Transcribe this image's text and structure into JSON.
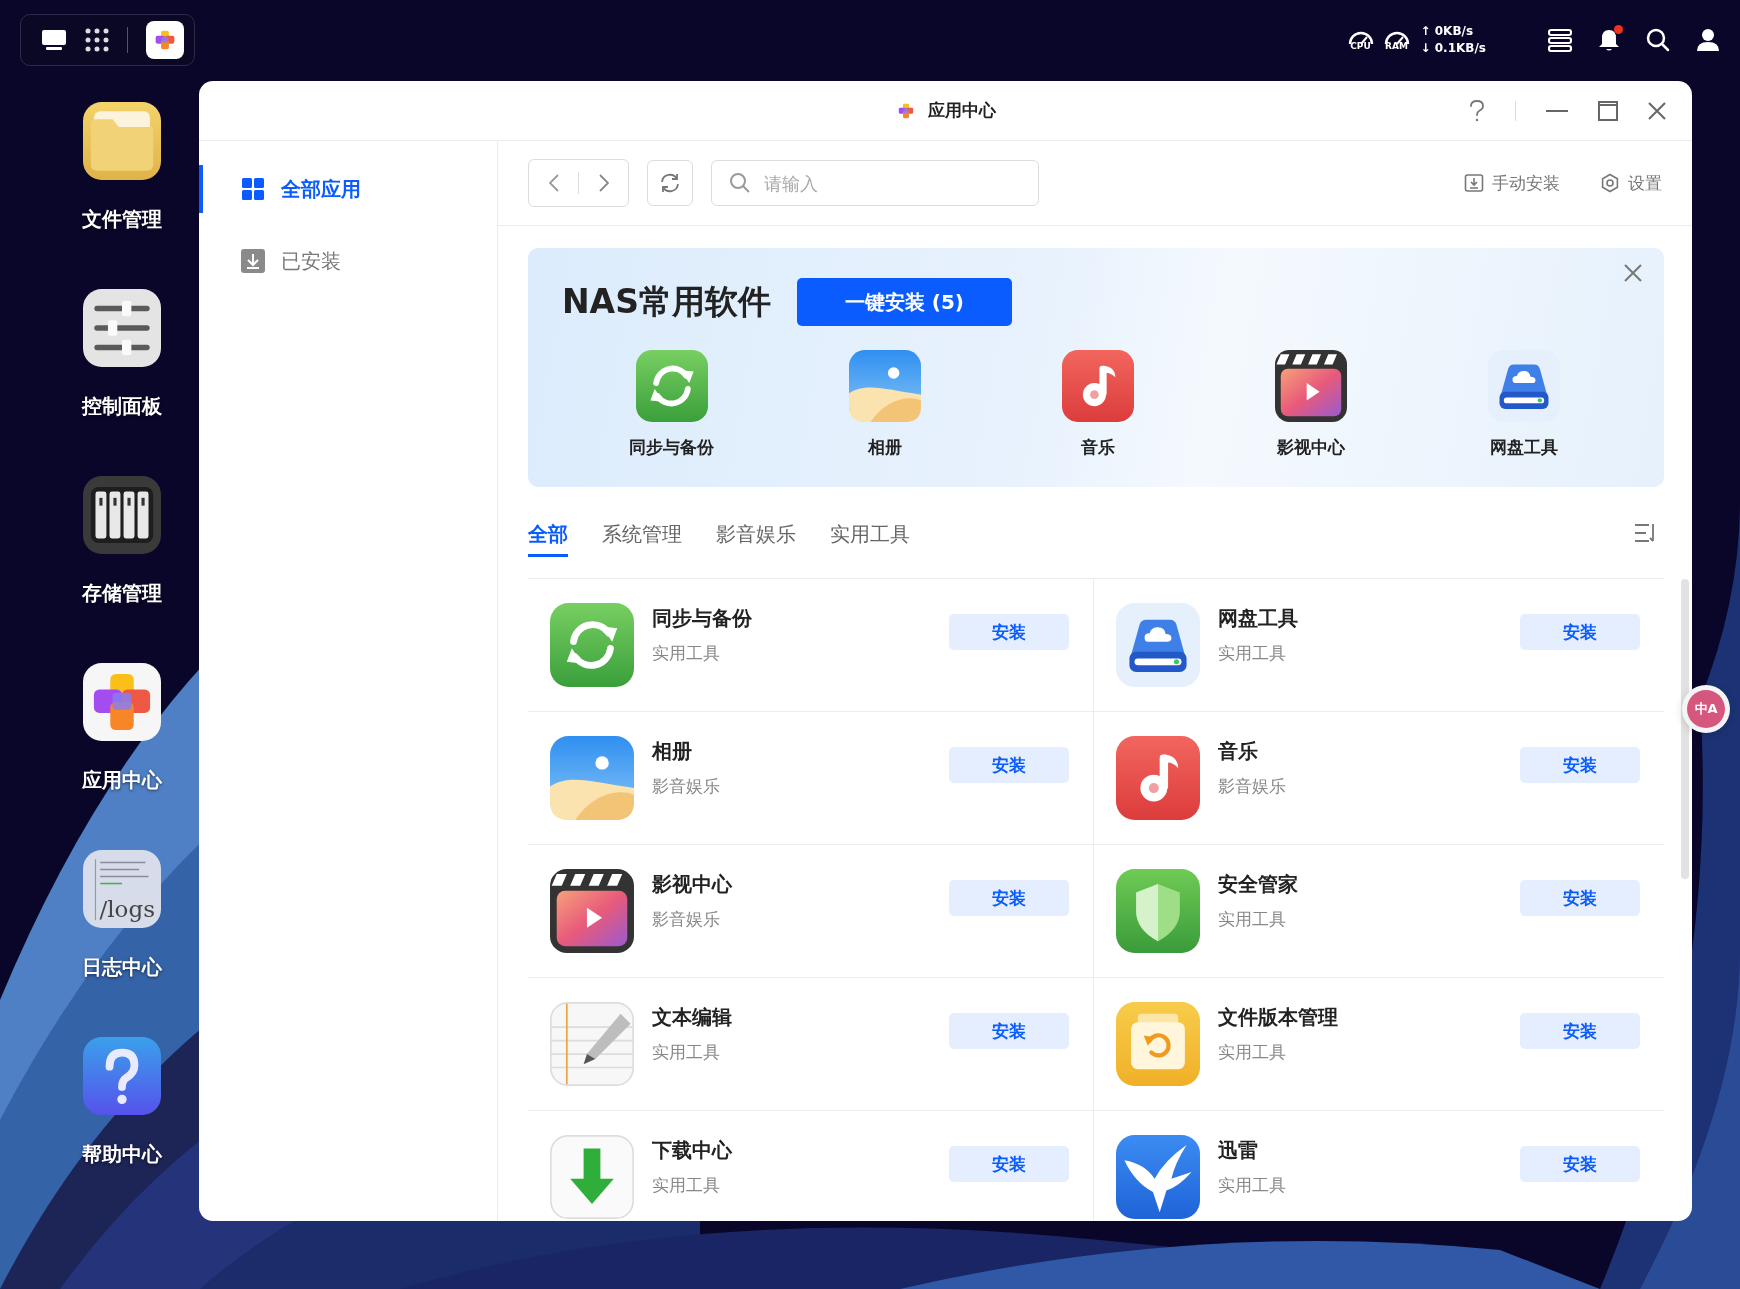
{
  "status": {
    "cpu_label": "CPU",
    "ram_label": "RAM",
    "upload": "↑ 0KB/s",
    "download": "↓ 0.1KB/s",
    "notifications_unread": true
  },
  "desktop_icons": [
    {
      "label": "文件管理",
      "kind": "folder"
    },
    {
      "label": "控制面板",
      "kind": "sliders"
    },
    {
      "label": "存储管理",
      "kind": "storage"
    },
    {
      "label": "应用中心",
      "kind": "appcenter"
    },
    {
      "label": "日志中心",
      "kind": "logs",
      "icon_text": "/logs"
    },
    {
      "label": "帮助中心",
      "kind": "help"
    }
  ],
  "window": {
    "title": "应用中心"
  },
  "sidebar": {
    "items": [
      {
        "label": "全部应用",
        "kind": "grid",
        "selected": true
      },
      {
        "label": "已安装",
        "kind": "installed",
        "selected": false
      }
    ]
  },
  "toolbar": {
    "search": {
      "placeholder": "请输入"
    },
    "actions": [
      {
        "label": "手动安装",
        "kind": "install"
      },
      {
        "label": "设置",
        "kind": "settings"
      }
    ]
  },
  "banner": {
    "title": "NAS常用软件",
    "button": "一键安装 (5)",
    "apps": [
      {
        "label": "同步与备份",
        "kind": "sync"
      },
      {
        "label": "相册",
        "kind": "photos"
      },
      {
        "label": "音乐",
        "kind": "music"
      },
      {
        "label": "影视中心",
        "kind": "video"
      },
      {
        "label": "网盘工具",
        "kind": "disk"
      }
    ]
  },
  "tabs": [
    {
      "label": "全部",
      "selected": true
    },
    {
      "label": "系统管理",
      "selected": false
    },
    {
      "label": "影音娱乐",
      "selected": false
    },
    {
      "label": "实用工具",
      "selected": false
    }
  ],
  "apps": [
    {
      "name": "同步与备份",
      "category": "实用工具",
      "kind": "sync",
      "button": "安装"
    },
    {
      "name": "网盘工具",
      "category": "实用工具",
      "kind": "disk",
      "button": "安装"
    },
    {
      "name": "相册",
      "category": "影音娱乐",
      "kind": "photos",
      "button": "安装"
    },
    {
      "name": "音乐",
      "category": "影音娱乐",
      "kind": "music",
      "button": "安装"
    },
    {
      "name": "影视中心",
      "category": "影音娱乐",
      "kind": "video",
      "button": "安装"
    },
    {
      "name": "安全管家",
      "category": "实用工具",
      "kind": "shield",
      "button": "安装"
    },
    {
      "name": "文本编辑",
      "category": "实用工具",
      "kind": "text",
      "button": "安装"
    },
    {
      "name": "文件版本管理",
      "category": "实用工具",
      "kind": "version",
      "button": "安装"
    },
    {
      "name": "下载中心",
      "category": "实用工具",
      "kind": "download",
      "button": "安装"
    },
    {
      "name": "迅雷",
      "category": "实用工具",
      "kind": "thunder",
      "button": "安装"
    }
  ],
  "translate_button": {
    "label": "中A"
  }
}
